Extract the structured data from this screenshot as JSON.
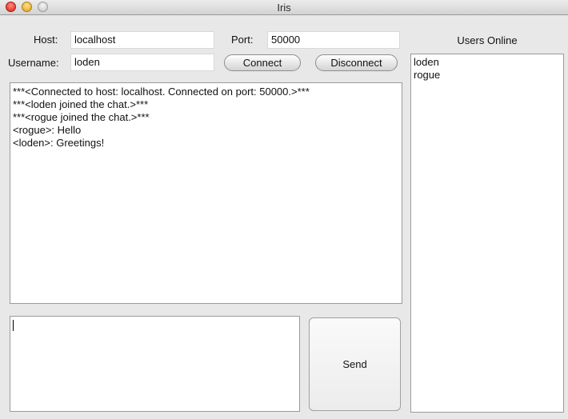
{
  "window": {
    "title": "Iris"
  },
  "connection": {
    "host_label": "Host:",
    "host_value": "localhost",
    "port_label": "Port:",
    "port_value": "50000",
    "username_label": "Username:",
    "username_value": "loden",
    "connect_label": "Connect",
    "disconnect_label": "Disconnect"
  },
  "chat": {
    "messages": [
      "***<Connected to host: localhost. Connected on port: 50000.>***",
      "***<loden joined the chat.>***",
      "***<rogue joined the chat.>***",
      "<rogue>: Hello",
      "<loden>: Greetings!"
    ]
  },
  "users": {
    "heading": "Users Online",
    "list": [
      "loden",
      "rogue"
    ]
  },
  "compose": {
    "value": "",
    "send_label": "Send"
  }
}
